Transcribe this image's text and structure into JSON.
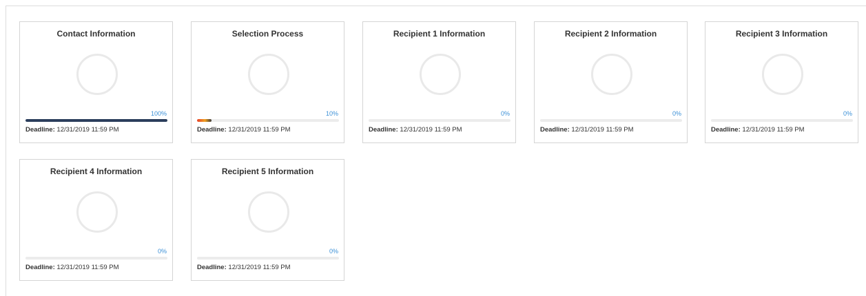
{
  "cards": [
    {
      "title": "Contact Information",
      "progress": 100,
      "pct_label": "100%",
      "deadline_label": "Deadline:",
      "deadline": "12/31/2019 11:59 PM",
      "bar_style": "solid"
    },
    {
      "title": "Selection Process",
      "progress": 10,
      "pct_label": "10%",
      "deadline_label": "Deadline:",
      "deadline": "12/31/2019 11:59 PM",
      "bar_style": "gradient"
    },
    {
      "title": "Recipient 1 Information",
      "progress": 0,
      "pct_label": "0%",
      "deadline_label": "Deadline:",
      "deadline": "12/31/2019 11:59 PM",
      "bar_style": "solid"
    },
    {
      "title": "Recipient 2 Information",
      "progress": 0,
      "pct_label": "0%",
      "deadline_label": "Deadline:",
      "deadline": "12/31/2019 11:59 PM",
      "bar_style": "solid"
    },
    {
      "title": "Recipient 3 Information",
      "progress": 0,
      "pct_label": "0%",
      "deadline_label": "Deadline:",
      "deadline": "12/31/2019 11:59 PM",
      "bar_style": "solid"
    },
    {
      "title": "Recipient 4 Information",
      "progress": 0,
      "pct_label": "0%",
      "deadline_label": "Deadline:",
      "deadline": "12/31/2019 11:59 PM",
      "bar_style": "solid"
    },
    {
      "title": "Recipient 5 Information",
      "progress": 0,
      "pct_label": "0%",
      "deadline_label": "Deadline:",
      "deadline": "12/31/2019 11:59 PM",
      "bar_style": "solid"
    }
  ],
  "colors": {
    "bar_solid": "#2b3e5c",
    "bar_gradient": [
      "#e8402a",
      "#f0a020",
      "#3b3b3b"
    ],
    "percent_text": "#3a8fd6",
    "ring": "#e9e9e9"
  }
}
